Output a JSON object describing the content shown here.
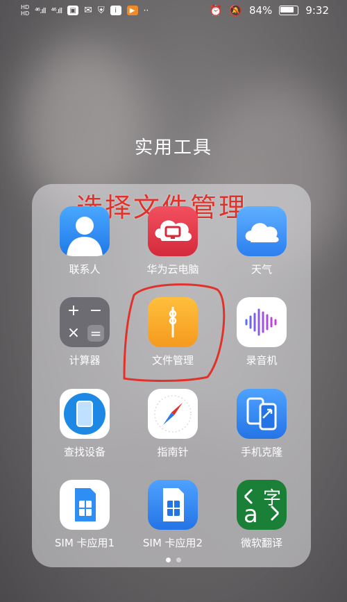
{
  "status_bar": {
    "hd1": "HD",
    "hd2": "HD",
    "signal1": "⁴⁶.ıll",
    "signal2": "⁴⁶.ıll",
    "battery_percent": "84%",
    "time": "9:32",
    "more": "··"
  },
  "folder": {
    "title": "实用工具",
    "annotation": "选择文件管理"
  },
  "apps": [
    {
      "label": "联系人",
      "color": "#2f8ef3"
    },
    {
      "label": "华为云电脑",
      "color": "#e8384a"
    },
    {
      "label": "天气",
      "color": "#3c8ff5"
    },
    {
      "label": "计算器",
      "color": "#6c6c72"
    },
    {
      "label": "文件管理",
      "color": "#f8a72c"
    },
    {
      "label": "录音机",
      "color": "#ffffff"
    },
    {
      "label": "查找设备",
      "color": "#1e88e5"
    },
    {
      "label": "指南针",
      "color": "#ffffff"
    },
    {
      "label": "手机克隆",
      "color": "#2e86f0"
    },
    {
      "label": "SIM 卡应用1",
      "color": "#ffffff"
    },
    {
      "label": "SIM 卡应用2",
      "color": "#2e86f0"
    },
    {
      "label": "微软翻译",
      "color": "#1a7f37"
    }
  ],
  "calculator_symbols": [
    "+",
    "−",
    "×",
    "="
  ],
  "translator_glyphs": {
    "top": "字",
    "bottom": "a"
  },
  "pager": {
    "pages": 2,
    "active_index": 0
  }
}
